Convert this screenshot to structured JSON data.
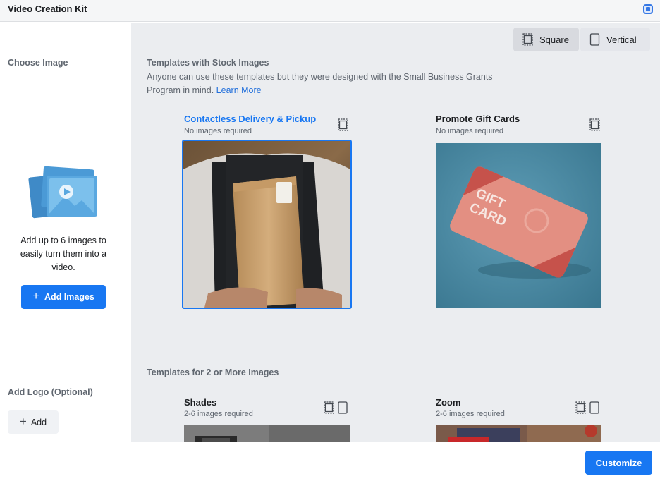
{
  "window": {
    "title": "Video Creation Kit"
  },
  "sidebar": {
    "choose_image_label": "Choose Image",
    "help_text": "Add up to 6 images to easily turn them into a video.",
    "add_images_label": "Add Images",
    "add_logo_label": "Add Logo (Optional)",
    "add_button_label": "Add"
  },
  "format_toggle": {
    "options": [
      {
        "label": "Square",
        "icon": "square-format-icon",
        "selected": true
      },
      {
        "label": "Vertical",
        "icon": "vertical-format-icon",
        "selected": false
      }
    ]
  },
  "stock_section": {
    "heading": "Templates with Stock Images",
    "description": "Anyone can use these templates but they were designed with the Small Business Grants Program in mind.",
    "learn_more": "Learn More",
    "templates": [
      {
        "title": "Contactless Delivery & Pickup",
        "subtitle": "No images required",
        "selected": true,
        "thumbnail": "person holding paper bag"
      },
      {
        "title": "Promote Gift Cards",
        "subtitle": "No images required",
        "selected": false,
        "thumbnail": "gift card on teal background",
        "card_text": [
          "GIFT",
          "CARD"
        ]
      }
    ]
  },
  "multi_section": {
    "heading": "Templates for 2 or More Images",
    "templates": [
      {
        "title": "Shades",
        "subtitle": "2-6 images required"
      },
      {
        "title": "Zoom",
        "subtitle": "2-6 images required"
      }
    ]
  },
  "footer": {
    "customize_label": "Customize"
  },
  "colors": {
    "accent": "#1877f2",
    "panel_bg": "#ebedf0",
    "muted_text": "#606770"
  }
}
